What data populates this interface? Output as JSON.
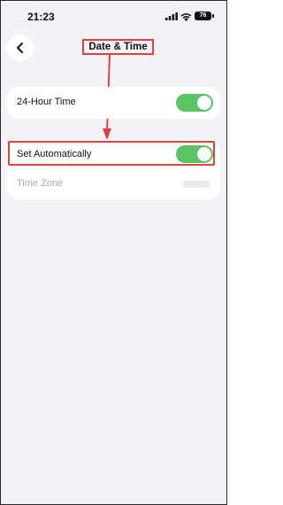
{
  "status_bar": {
    "time": "21:23",
    "battery": "76",
    "icons": [
      "signal-icon",
      "wifi-icon",
      "battery-icon"
    ]
  },
  "header": {
    "title": "Date & Time",
    "back_icon": "chevron-left-icon"
  },
  "settings": {
    "hour_24": {
      "label": "24-Hour Time",
      "enabled": true
    },
    "set_automatically": {
      "label": "Set Automatically",
      "enabled": true
    },
    "time_zone": {
      "label": "Time Zone"
    }
  },
  "colors": {
    "toggle_on": "#5ac466",
    "annotation": "#e04040",
    "background": "#f2f2f7"
  }
}
